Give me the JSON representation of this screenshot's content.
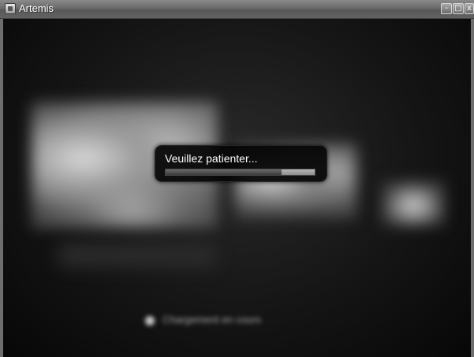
{
  "window": {
    "title": "Artemis",
    "controls": {
      "minimize": "-",
      "maximize": "□",
      "close": "x"
    }
  },
  "loading_dialog": {
    "message": "Veuillez patienter...",
    "progress": 0.78
  },
  "background": {
    "footer_text": "Chargement en cours"
  }
}
